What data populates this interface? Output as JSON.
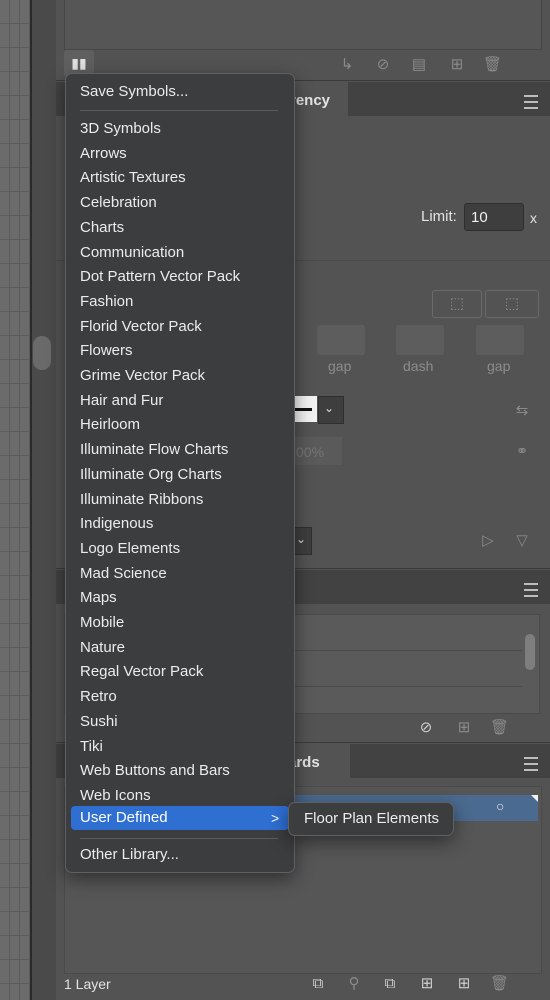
{
  "symbols_menu": {
    "save": "Save Symbols...",
    "items": [
      "3D Symbols",
      "Arrows",
      "Artistic Textures",
      "Celebration",
      "Charts",
      "Communication",
      "Dot Pattern Vector Pack",
      "Fashion",
      "Florid Vector Pack",
      "Flowers",
      "Grime Vector Pack",
      "Hair and Fur",
      "Heirloom",
      "Illuminate Flow Charts",
      "Illuminate Org Charts",
      "Illuminate Ribbons",
      "Indigenous",
      "Logo Elements",
      "Mad Science",
      "Maps",
      "Mobile",
      "Nature",
      "Regal Vector Pack",
      "Retro",
      "Sushi",
      "Tiki",
      "Web Buttons and Bars",
      "Web Icons"
    ],
    "user_defined": "User Defined",
    "submenu_arrow": ">",
    "other": "Other Library...",
    "highlight_color": "#2f6fd2"
  },
  "submenu": {
    "item": "Floor Plan Elements"
  },
  "stroke_panel": {
    "tab_partial": "rency",
    "limit_label": "Limit:",
    "limit_value": "10",
    "limit_unit": "x",
    "gap1": "gap",
    "dash": "dash",
    "gap2": "gap",
    "percent": "00%"
  },
  "middle_panel": {
    "row_partial": ":"
  },
  "artboards_panel": {
    "tab_partial": "ards"
  },
  "layers_footer": {
    "layer_count": "1 Layer"
  },
  "symbol_library_icon": "library-books-icon"
}
